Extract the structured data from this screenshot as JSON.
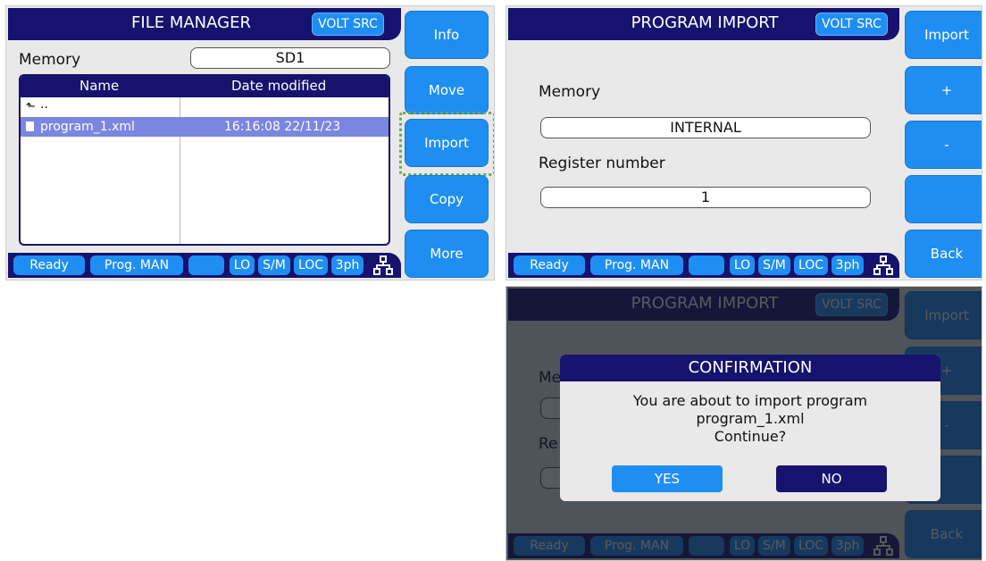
{
  "file_manager": {
    "title": "FILE MANAGER",
    "mode_badge": "VOLT SRC",
    "memory_label": "Memory",
    "memory_value": "SD1",
    "table": {
      "columns": [
        "Name",
        "Date modified"
      ],
      "rows": [
        {
          "icon": "up-arrow-icon",
          "name": "..",
          "date": ""
        },
        {
          "icon": "file-icon",
          "name": "program_1.xml",
          "date": "16:16:08 22/11/23",
          "selected": true
        }
      ]
    },
    "side_buttons": [
      "Info",
      "Move",
      "Import",
      "Copy",
      "More"
    ],
    "highlighted_button": "Import"
  },
  "program_import": {
    "title": "PROGRAM IMPORT",
    "mode_badge": "VOLT SRC",
    "memory_label": "Memory",
    "memory_value": "INTERNAL",
    "register_label": "Register number",
    "register_value": "1",
    "side_buttons": [
      "Import",
      "+",
      "-",
      "",
      "Back"
    ]
  },
  "status_bar": {
    "state": "Ready",
    "program": "Prog. MAN",
    "empty": "",
    "lo": "LO",
    "sm": "S/M",
    "loc": "LOC",
    "phase": "3ph",
    "network_icon": "network-icon"
  },
  "confirmation": {
    "title": "CONFIRMATION",
    "line1": "You are about to import program",
    "line2": "program_1.xml",
    "line3": "Continue?",
    "yes": "YES",
    "no": "NO",
    "bg_fragments": {
      "me": "Me",
      "re": "Re"
    }
  },
  "colors": {
    "navy": "#16126e",
    "button_blue": "#1f8ef2",
    "selection": "#7a86e0",
    "highlight_dots": "#6aa84f"
  }
}
